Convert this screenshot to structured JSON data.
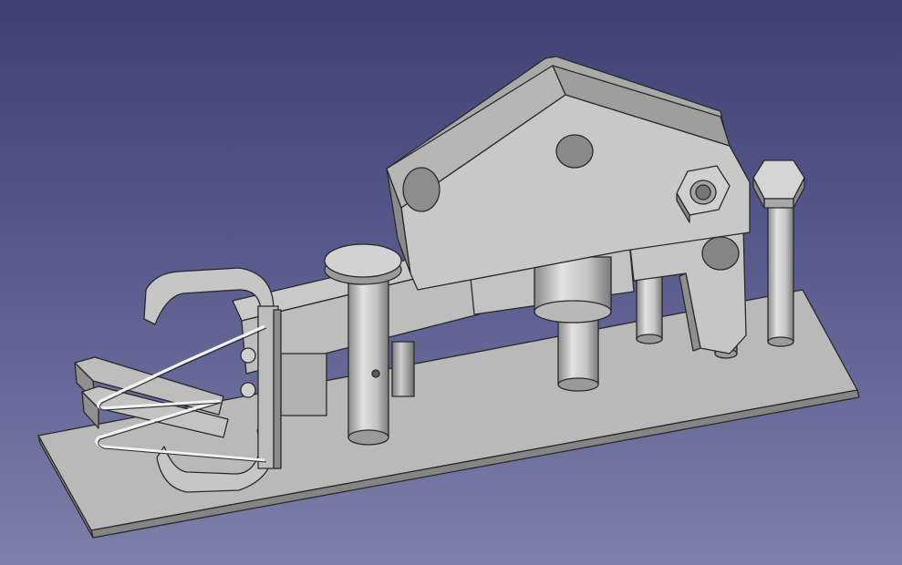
{
  "viewer": {
    "background_top": "#3f4173",
    "background_bottom": "#7d80aa",
    "part_color": "#c8c8c8",
    "part_shade": "#8e8e8e",
    "edge_color": "#2a2a2a"
  },
  "model": {
    "parts": [
      "base-plate",
      "clamp-arm",
      "spring-clip",
      "main-lever",
      "pivot-pin",
      "center-post",
      "rear-posts",
      "hex-nut",
      "hex-bolt"
    ]
  }
}
